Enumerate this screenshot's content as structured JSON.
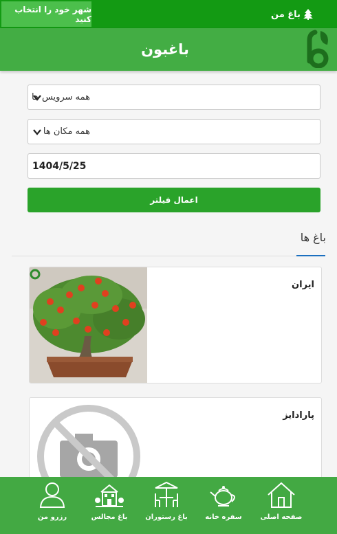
{
  "topbar": {
    "city_button": "شهر خود را انتخاب کنید",
    "my_garden": "باغ من"
  },
  "header": {
    "title": "باغبون",
    "logo_icon": "leaf-b-logo-icon"
  },
  "filters": {
    "service_select": "همه سرویس ها",
    "location_select": "همه مکان ها",
    "date_value": "1404/5/25",
    "apply_button": "اعمال فیلتر"
  },
  "section": {
    "title": "باغ ها"
  },
  "gardens": [
    {
      "name": "ایران",
      "image": "bonsai-photo"
    },
    {
      "name": "پارادایز",
      "image": "no-camera-placeholder-icon"
    }
  ],
  "bottom_nav": [
    {
      "label": "صفحه اصلی",
      "icon": "home-icon"
    },
    {
      "label": "سفره خانه",
      "icon": "teapot-icon"
    },
    {
      "label": "باغ رستوران",
      "icon": "restaurant-table-icon"
    },
    {
      "label": "باغ مجالس",
      "icon": "hall-building-icon"
    },
    {
      "label": "رزرو من",
      "icon": "user-icon"
    }
  ],
  "colors": {
    "topbar": "#139a13",
    "header": "#43ad44",
    "button": "#2aa32a",
    "bottom_nav": "#43a943",
    "tab_underline": "#1b6fbf"
  }
}
